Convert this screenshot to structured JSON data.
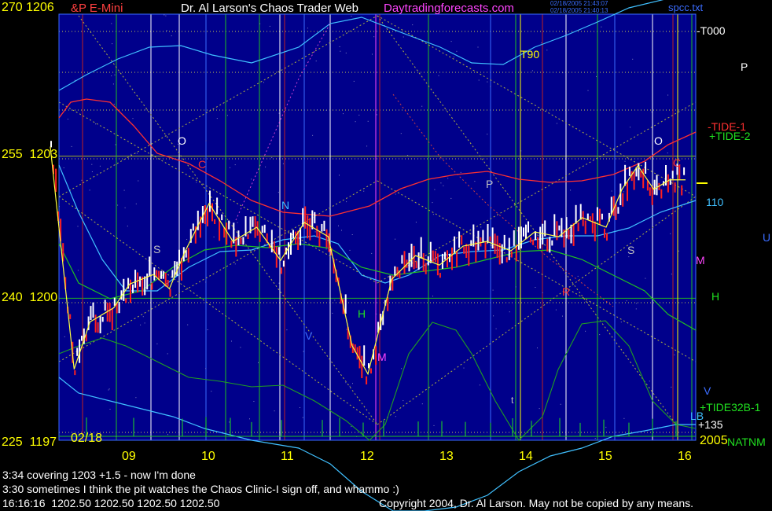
{
  "header": {
    "symbol_prefix": "270",
    "symbol_price": "1206",
    "symbol": "&P E-Mini",
    "title": "Dr. Al Larson's Chaos Trader Web",
    "site": "Daytradingforecasts.com",
    "stamp_line1": "02/18/2005 21:43:07",
    "stamp_line2": "02/18/2005 21:40:13",
    "file": "spcc.txt"
  },
  "y_labels": [
    {
      "key": "270",
      "a": "270",
      "b": "1206"
    },
    {
      "key": "255",
      "a": "255",
      "b": "1203"
    },
    {
      "key": "240",
      "a": "240",
      "b": "1200"
    },
    {
      "key": "225",
      "a": "225",
      "b": "1197"
    }
  ],
  "x_axis": {
    "date": "02/18",
    "year": "2005",
    "ticks": [
      "09",
      "10",
      "11",
      "12",
      "13",
      "14",
      "15",
      "16"
    ]
  },
  "annotations": {
    "t000": "-T000",
    "t90": "T90",
    "p_right": "P",
    "tide1": "-TIDE-1",
    "tide2": "+TIDE-2",
    "v110": "110",
    "u": "U",
    "m_right": "M",
    "h_right": "H",
    "v_right": "V",
    "tide32b": "+TIDE32B-1",
    "p135": "+135",
    "nat": "NATNM",
    "ulb": "LB",
    "o1": "O",
    "c1": "C",
    "s1": "S",
    "n1": "N",
    "v1": "V",
    "h1": "H",
    "m1": "M",
    "p1": "P",
    "r1": "R",
    "s2": "S",
    "o2": "O",
    "c2": "C",
    "t1": "t"
  },
  "chat": [
    "3:34 covering 1203 +1.5 - now I'm done",
    "3:30 sometimes I think the pit watches the Chaos Clinic-I sign off, and whammo :)"
  ],
  "status": {
    "time": "16:16:16",
    "v1": "1202.50",
    "v2": "1202.50",
    "v3": "1202.50",
    "v4": "1202.50",
    "copyright": "Copyright 2004, Dr. Al Larson. May not be copied by any means."
  },
  "colors": {
    "bg_plot": "#00008b",
    "bg_outer": "#000000",
    "axis_text": "#ffff00",
    "price_up": "#ffffff",
    "price_down": "#ff2020",
    "title_white": "#ffffff",
    "site_magenta": "#ff44ff",
    "tide1": "#ff3030",
    "tide2": "#20c020",
    "cyan": "#40c0ff"
  },
  "chart_data": {
    "type": "line",
    "title": "Dr. Al Larson's Chaos Trader Web",
    "x_ticks": [
      "09",
      "10",
      "11",
      "12",
      "13",
      "14",
      "15",
      "16"
    ],
    "y_ticks": [
      "1197",
      "1200",
      "1203",
      "1206"
    ],
    "series": [
      {
        "name": "S&P E-Mini",
        "x": [
          8.0,
          8.3,
          8.5,
          8.8,
          9.0,
          9.3,
          9.5,
          9.7,
          10.0,
          10.3,
          10.6,
          10.9,
          11.2,
          11.5,
          11.8,
          12.0,
          12.3,
          12.6,
          12.9,
          13.2,
          13.5,
          13.8,
          14.1,
          14.4,
          14.7,
          15.0,
          15.2,
          15.4,
          15.6,
          15.8,
          16.0
        ],
        "values": [
          1203.2,
          1198.5,
          1199.5,
          1199.8,
          1200.3,
          1200.5,
          1200.2,
          1201.0,
          1202.0,
          1201.2,
          1201.5,
          1200.8,
          1201.6,
          1201.3,
          1199.0,
          1198.4,
          1200.4,
          1200.9,
          1200.7,
          1201.1,
          1201.2,
          1201.0,
          1201.4,
          1201.3,
          1201.7,
          1201.5,
          1202.3,
          1202.8,
          1202.3,
          1202.5,
          1202.5
        ]
      }
    ]
  }
}
